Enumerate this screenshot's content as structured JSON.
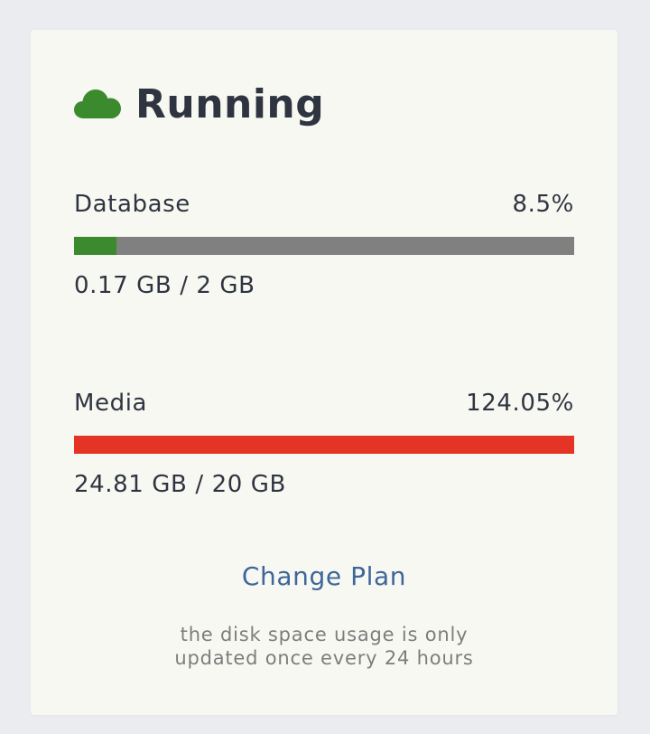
{
  "status": {
    "label": "Running",
    "icon": "cloud-icon",
    "icon_color": "#3c8a2e"
  },
  "meters": [
    {
      "label": "Database",
      "percent_text": "8.5%",
      "usage_text": "0.17 GB / 2 GB",
      "fill_fraction": 0.085,
      "fill_color": "#3c8a2e"
    },
    {
      "label": "Media",
      "percent_text": "124.05%",
      "usage_text": "24.81 GB / 20 GB",
      "fill_fraction": 1.0,
      "fill_color": "#e43425"
    }
  ],
  "actions": {
    "change_plan": "Change Plan"
  },
  "note": {
    "line1": "the disk space usage is only",
    "line2": "updated once every 24 hours"
  },
  "colors": {
    "track": "#808080",
    "link": "#3e6699",
    "text": "#2f3540"
  }
}
